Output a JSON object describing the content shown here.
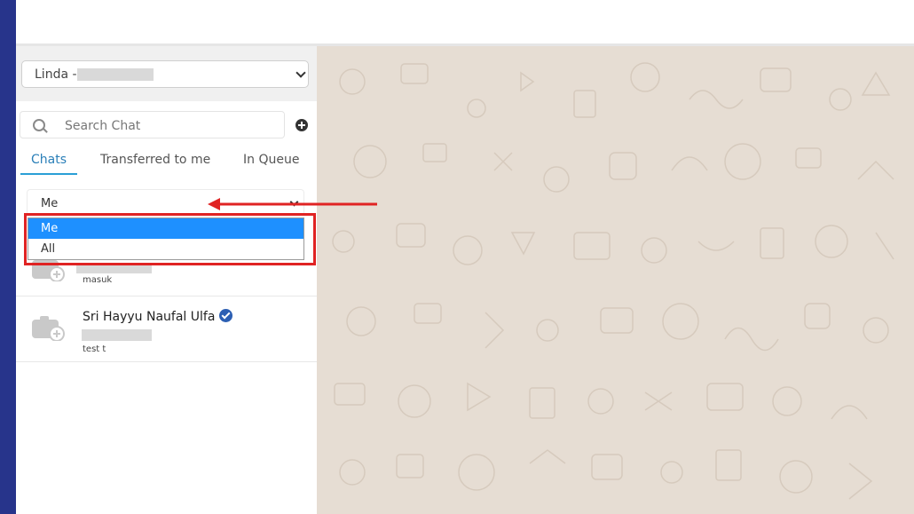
{
  "agent_select": {
    "name": "Linda -"
  },
  "search": {
    "placeholder": "Search Chat"
  },
  "tabs": [
    {
      "label": "Chats"
    },
    {
      "label": "Transferred to me"
    },
    {
      "label": "In Queue"
    }
  ],
  "filter": {
    "selected": "Me",
    "options": [
      "Me",
      "All"
    ]
  },
  "chats": [
    {
      "name": "",
      "preview": "masuk"
    },
    {
      "name": "Sri Hayyu Naufal Ulfa",
      "preview": "test t",
      "verified": true
    }
  ],
  "icons": {
    "search": "search-icon",
    "add": "plus-circle-icon",
    "chevron": "chevron-down-icon",
    "camera": "camera-add-icon",
    "verified": "verified-badge-icon"
  },
  "colors": {
    "rail": "#27348b",
    "chat_background": "#e6ddd3",
    "active_tab": "#2a9fd6",
    "selected_option": "#1e90ff",
    "annotation": "#e02323"
  }
}
